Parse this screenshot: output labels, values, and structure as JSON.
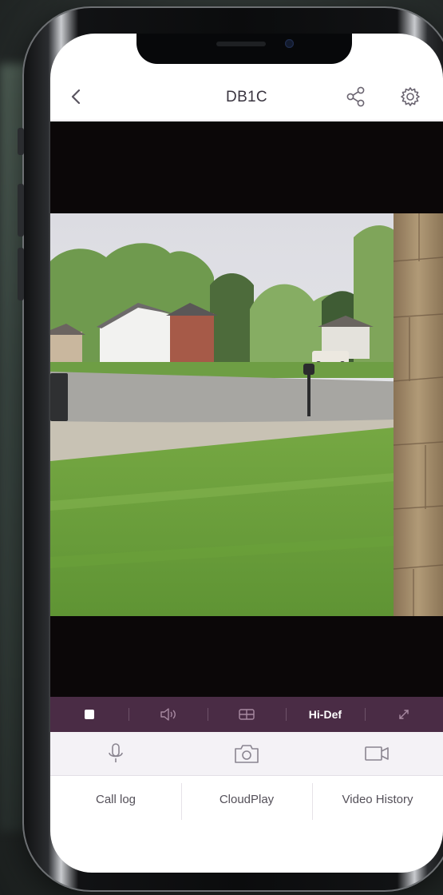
{
  "header": {
    "title": "DB1C",
    "back_icon": "chevron-left-icon",
    "share_icon": "share-icon",
    "settings_icon": "gear-icon"
  },
  "video": {
    "description_icon": "live-camera-feed"
  },
  "control_bar": {
    "items": [
      {
        "icon": "stop-square-icon"
      },
      {
        "icon": "speaker-icon"
      },
      {
        "icon": "split-view-icon"
      },
      {
        "label": "Hi-Def"
      },
      {
        "icon": "fullscreen-icon"
      }
    ]
  },
  "actions": [
    {
      "icon": "microphone-icon"
    },
    {
      "icon": "camera-icon"
    },
    {
      "icon": "video-camera-icon"
    }
  ],
  "tabs": [
    {
      "label": "Call log"
    },
    {
      "label": "CloudPlay"
    },
    {
      "label": "Video History"
    }
  ],
  "colors": {
    "control_bar_bg": "#4a2c45",
    "header_text": "#3a3540",
    "tab_text": "#545059"
  }
}
